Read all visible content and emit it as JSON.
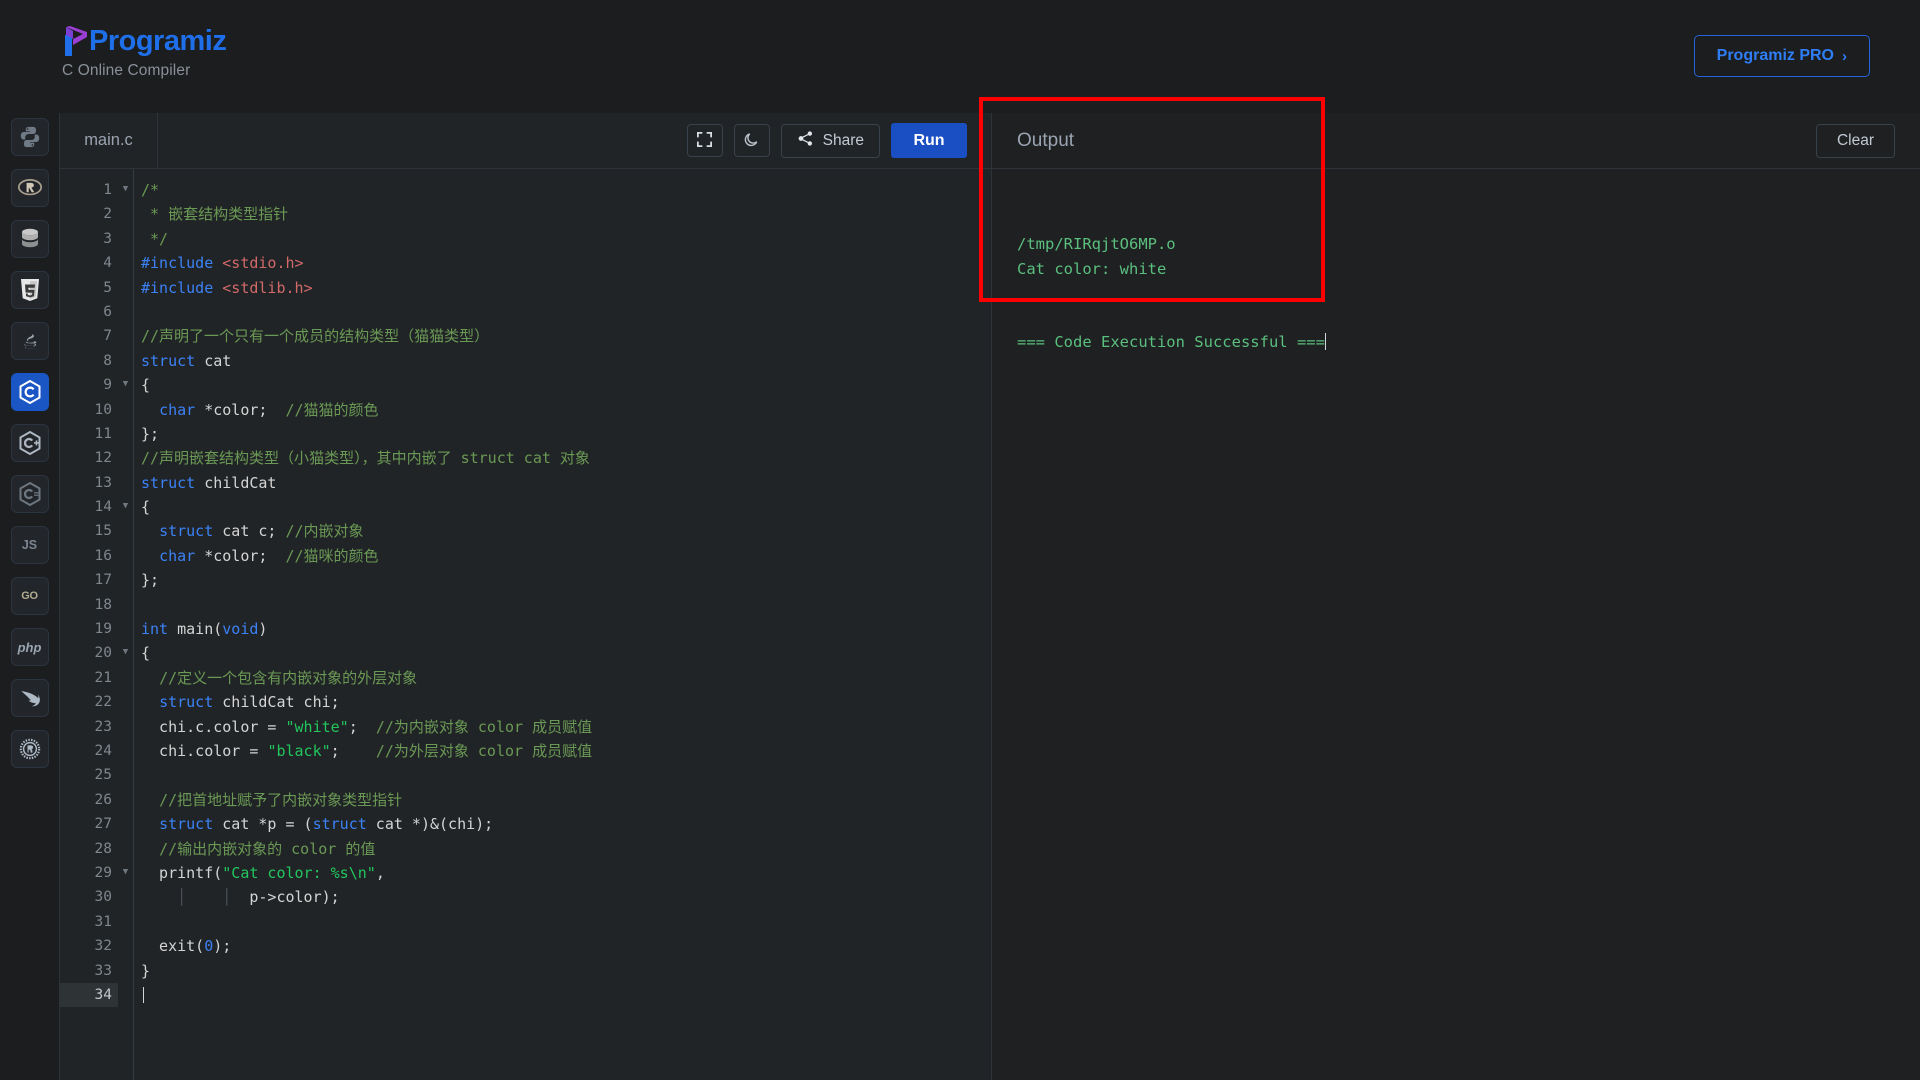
{
  "header": {
    "brand_name": "Programiz",
    "subtitle": "C Online Compiler",
    "pro_button": "Programiz PRO",
    "pro_chevron": "›",
    "logo_colors": {
      "purple": "#9b3fd4",
      "blue": "#1f6feb"
    }
  },
  "sidebar": {
    "items": [
      {
        "name": "python",
        "label": "Python",
        "active": false
      },
      {
        "name": "r",
        "label": "R",
        "active": false
      },
      {
        "name": "sql",
        "label": "SQL",
        "active": false
      },
      {
        "name": "html",
        "label": "HTML",
        "active": false
      },
      {
        "name": "java",
        "label": "Java",
        "active": false
      },
      {
        "name": "c",
        "label": "C",
        "active": true
      },
      {
        "name": "cpp",
        "label": "C++",
        "active": false
      },
      {
        "name": "csharp",
        "label": "C#",
        "active": false
      },
      {
        "name": "javascript",
        "label": "JS",
        "active": false
      },
      {
        "name": "go",
        "label": "GO",
        "active": false
      },
      {
        "name": "php",
        "label": "php",
        "active": false
      },
      {
        "name": "swift",
        "label": "Swift",
        "active": false
      },
      {
        "name": "rust",
        "label": "Rust",
        "active": false
      }
    ]
  },
  "editor": {
    "tab_label": "main.c",
    "fullscreen_icon": "fullscreen-icon",
    "theme_icon": "moon-icon",
    "share_label": "Share",
    "share_icon": "share-icon",
    "run_label": "Run",
    "active_line": 34,
    "total_lines": 34,
    "lines": [
      {
        "n": 1,
        "fold": true,
        "tokens": [
          [
            "c-com",
            "/*"
          ]
        ]
      },
      {
        "n": 2,
        "fold": false,
        "tokens": [
          [
            "c-com",
            " * 嵌套结构类型指针"
          ]
        ]
      },
      {
        "n": 3,
        "fold": false,
        "tokens": [
          [
            "c-com",
            " */"
          ]
        ]
      },
      {
        "n": 4,
        "fold": false,
        "tokens": [
          [
            "c-pre",
            "#include"
          ],
          [
            "c-plain",
            " "
          ],
          [
            "c-str2",
            "<stdio.h>"
          ]
        ]
      },
      {
        "n": 5,
        "fold": false,
        "tokens": [
          [
            "c-pre",
            "#include"
          ],
          [
            "c-plain",
            " "
          ],
          [
            "c-str2",
            "<stdlib.h>"
          ]
        ]
      },
      {
        "n": 6,
        "fold": false,
        "tokens": []
      },
      {
        "n": 7,
        "fold": false,
        "tokens": [
          [
            "c-com",
            "//声明了一个只有一个成员的结构类型（猫猫类型）"
          ]
        ]
      },
      {
        "n": 8,
        "fold": false,
        "tokens": [
          [
            "c-kw",
            "struct"
          ],
          [
            "c-plain",
            " cat"
          ]
        ]
      },
      {
        "n": 9,
        "fold": true,
        "tokens": [
          [
            "c-plain",
            "{"
          ]
        ]
      },
      {
        "n": 10,
        "fold": false,
        "tokens": [
          [
            "c-plain",
            "  "
          ],
          [
            "c-kw",
            "char"
          ],
          [
            "c-plain",
            " *color;  "
          ],
          [
            "c-com",
            "//猫猫的颜色"
          ]
        ]
      },
      {
        "n": 11,
        "fold": false,
        "tokens": [
          [
            "c-plain",
            "};"
          ]
        ]
      },
      {
        "n": 12,
        "fold": false,
        "tokens": [
          [
            "c-com",
            "//声明嵌套结构类型（小猫类型），其中内嵌了 struct cat 对象"
          ]
        ]
      },
      {
        "n": 13,
        "fold": false,
        "tokens": [
          [
            "c-kw",
            "struct"
          ],
          [
            "c-plain",
            " childCat"
          ]
        ]
      },
      {
        "n": 14,
        "fold": true,
        "tokens": [
          [
            "c-plain",
            "{"
          ]
        ]
      },
      {
        "n": 15,
        "fold": false,
        "tokens": [
          [
            "c-plain",
            "  "
          ],
          [
            "c-kw",
            "struct"
          ],
          [
            "c-plain",
            " cat c; "
          ],
          [
            "c-com",
            "//内嵌对象"
          ]
        ]
      },
      {
        "n": 16,
        "fold": false,
        "tokens": [
          [
            "c-plain",
            "  "
          ],
          [
            "c-kw",
            "char"
          ],
          [
            "c-plain",
            " *color;  "
          ],
          [
            "c-com",
            "//猫咪的颜色"
          ]
        ]
      },
      {
        "n": 17,
        "fold": false,
        "tokens": [
          [
            "c-plain",
            "};"
          ]
        ]
      },
      {
        "n": 18,
        "fold": false,
        "tokens": []
      },
      {
        "n": 19,
        "fold": false,
        "tokens": [
          [
            "c-kw",
            "int"
          ],
          [
            "c-plain",
            " main("
          ],
          [
            "c-kw",
            "void"
          ],
          [
            "c-plain",
            ")"
          ]
        ]
      },
      {
        "n": 20,
        "fold": true,
        "tokens": [
          [
            "c-plain",
            "{"
          ]
        ]
      },
      {
        "n": 21,
        "fold": false,
        "tokens": [
          [
            "c-plain",
            "  "
          ],
          [
            "c-com",
            "//定义一个包含有内嵌对象的外层对象"
          ]
        ]
      },
      {
        "n": 22,
        "fold": false,
        "tokens": [
          [
            "c-plain",
            "  "
          ],
          [
            "c-kw",
            "struct"
          ],
          [
            "c-plain",
            " childCat chi;"
          ]
        ]
      },
      {
        "n": 23,
        "fold": false,
        "tokens": [
          [
            "c-plain",
            "  chi.c.color = "
          ],
          [
            "c-str",
            "\"white\""
          ],
          [
            "c-plain",
            ";  "
          ],
          [
            "c-com",
            "//为内嵌对象 color 成员赋值"
          ]
        ]
      },
      {
        "n": 24,
        "fold": false,
        "tokens": [
          [
            "c-plain",
            "  chi.color = "
          ],
          [
            "c-str",
            "\"black\""
          ],
          [
            "c-plain",
            ";    "
          ],
          [
            "c-com",
            "//为外层对象 color 成员赋值"
          ]
        ]
      },
      {
        "n": 25,
        "fold": false,
        "tokens": []
      },
      {
        "n": 26,
        "fold": false,
        "tokens": [
          [
            "c-plain",
            "  "
          ],
          [
            "c-com",
            "//把首地址赋予了内嵌对象类型指针"
          ]
        ]
      },
      {
        "n": 27,
        "fold": false,
        "tokens": [
          [
            "c-plain",
            "  "
          ],
          [
            "c-kw",
            "struct"
          ],
          [
            "c-plain",
            " cat *p = ("
          ],
          [
            "c-kw",
            "struct"
          ],
          [
            "c-plain",
            " cat *)&(chi);"
          ]
        ]
      },
      {
        "n": 28,
        "fold": false,
        "tokens": [
          [
            "c-plain",
            "  "
          ],
          [
            "c-com",
            "//输出内嵌对象的 color 的值"
          ]
        ]
      },
      {
        "n": 29,
        "fold": true,
        "tokens": [
          [
            "c-plain",
            "  printf("
          ],
          [
            "c-str",
            "\"Cat color: %s\\n\""
          ],
          [
            "c-plain",
            ","
          ]
        ]
      },
      {
        "n": 30,
        "fold": false,
        "tokens": [
          [
            "c-plain",
            "    "
          ],
          [
            "indent-g",
            "│"
          ],
          [
            "c-plain",
            "    "
          ],
          [
            "indent-g",
            "│"
          ],
          [
            "c-plain",
            "  p->color);"
          ]
        ]
      },
      {
        "n": 31,
        "fold": false,
        "tokens": []
      },
      {
        "n": 32,
        "fold": false,
        "tokens": [
          [
            "c-plain",
            "  exit("
          ],
          [
            "c-num",
            "0"
          ],
          [
            "c-plain",
            ");"
          ]
        ]
      },
      {
        "n": 33,
        "fold": false,
        "tokens": [
          [
            "c-plain",
            "}"
          ]
        ]
      },
      {
        "n": 34,
        "fold": false,
        "tokens": []
      }
    ]
  },
  "output": {
    "title": "Output",
    "clear_label": "Clear",
    "lines": [
      "/tmp/RIRqjtO6MP.o",
      "Cat color: white",
      "",
      "",
      "=== Code Execution Successful ==="
    ],
    "text_color": "#5bbf7e",
    "highlight_color": "#fe0000"
  }
}
